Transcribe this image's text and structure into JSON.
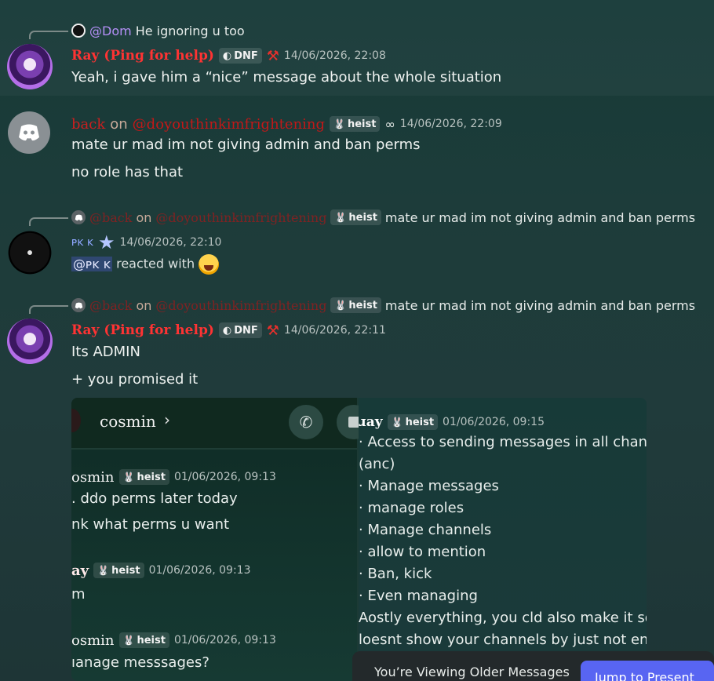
{
  "messages": {
    "m1": {
      "reply_mention": "@Dom",
      "reply_text": "He ignoring u too",
      "author": "Ray (Ping for help)",
      "badge": "DNF",
      "time": "14/06/2026, 22:08",
      "text": "Yeah, i gave him a “nice” message about the whole situation"
    },
    "m2": {
      "author_part1": "back",
      "author_part2": "on",
      "author_part3": "@doyouthinkimfrightening",
      "badge": "heist",
      "time": "14/06/2026, 22:09",
      "line1": "mate ur mad im not giving admin and ban perms",
      "line2": "no role has that"
    },
    "m3": {
      "reply_author1": "@back",
      "reply_on": "on",
      "reply_author2": "@doyouthinkimfrightening",
      "reply_badge": "heist",
      "reply_text": "mate ur mad im not giving admin and ban perms",
      "author": "ᴘᴋ ᴋ",
      "time": "14/06/2026, 22:10",
      "mention": "@ᴘᴋ ᴋ",
      "reaction_text": "reacted with"
    },
    "m4": {
      "reply_author1": "@back",
      "reply_on": "on",
      "reply_author2": "@doyouthinkimfrightening",
      "reply_badge": "heist",
      "reply_text": "mate ur mad im not giving admin and ban perms",
      "author": "Ray (Ping for help)",
      "badge": "DNF",
      "time": "14/06/2026, 22:11",
      "line1": "Its ADMIN",
      "line2": "+ you promised it"
    }
  },
  "attachment": {
    "left": {
      "header_name": "cosmin",
      "msgs": [
        {
          "name": "osmin",
          "badge": "heist",
          "time": "01/06/2026, 09:13",
          "lines": [
            ". ddo perms later today",
            "nk what perms u want"
          ]
        },
        {
          "name": "ay",
          "badge": "heist",
          "time": "01/06/2026, 09:13",
          "lines": [
            "m"
          ]
        },
        {
          "name": "osmin",
          "badge": "heist",
          "time": "01/06/2026, 09:13",
          "lines": [
            "ıanage messsages?"
          ]
        }
      ]
    },
    "right": {
      "name": "ɹay",
      "badge": "heist",
      "time": "01/06/2026, 09:15",
      "lines": [
        "·  Access to sending messages in all chan",
        "   (anc)",
        "·  Manage messages",
        "·  manage roles",
        "·  Manage channels",
        "·  allow to mention",
        "·  Ban, kick",
        "·  Even managing",
        "Aostly everything, you cld also make it so",
        "loesnt show your channels by just not ena"
      ]
    }
  },
  "footer": {
    "older_text": "You’re Viewing Older Messages",
    "jump_label": "Jump to Present"
  },
  "colors": {
    "accent": "#5865f2",
    "ray_name": "#ff3333",
    "mention": "#b58ff7"
  }
}
